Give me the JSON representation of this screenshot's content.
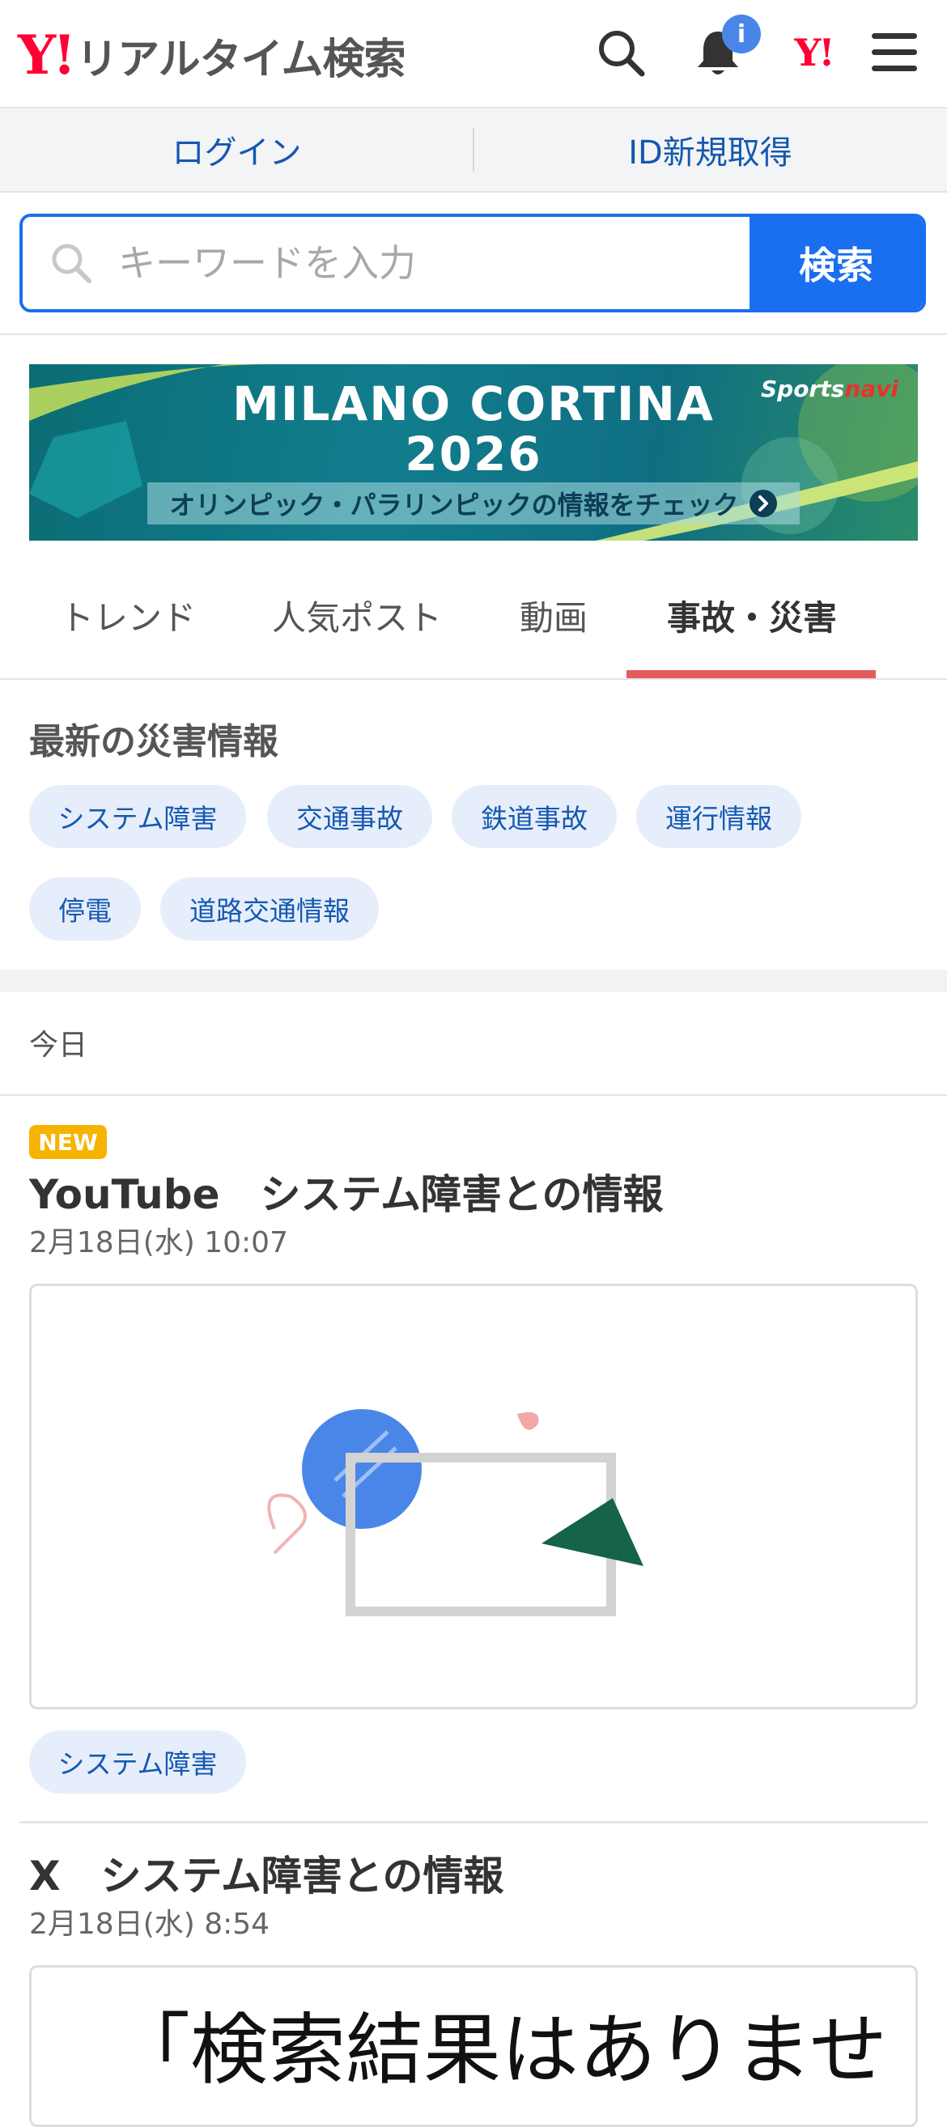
{
  "header": {
    "logo_y": "Y!",
    "logo_text": "リアルタイム検索",
    "notification_badge": "i",
    "yahoo_mini": "Y!"
  },
  "login_bar": {
    "login": "ログイン",
    "signup": "ID新規取得"
  },
  "search": {
    "placeholder": "キーワードを入力",
    "button": "検索"
  },
  "banner": {
    "title_line1": "MILANO CORTINA",
    "title_line2": "2026",
    "subtitle": "オリンピック・パラリンピックの情報をチェック",
    "brand_prefix": "Sports",
    "brand_suffix": "navi"
  },
  "tabs": [
    {
      "label": "トレンド",
      "active": false
    },
    {
      "label": "人気ポスト",
      "active": false
    },
    {
      "label": "動画",
      "active": false
    },
    {
      "label": "事故・災害",
      "active": true
    }
  ],
  "disaster": {
    "title": "最新の災害情報",
    "chips": [
      "システム障害",
      "交通事故",
      "鉄道事故",
      "運行情報",
      "停電",
      "道路交通情報"
    ]
  },
  "timeline": {
    "today_label": "今日"
  },
  "articles": [
    {
      "new_badge": "NEW",
      "title": "YouTube　システム障害との情報",
      "date": "2月18日(水) 10:07",
      "tag": "システム障害"
    },
    {
      "title": "X　システム障害との情報",
      "date": "2月18日(水) 8:54",
      "image_text": "「検索結果はありませ"
    }
  ],
  "colors": {
    "brand_red": "#ff0033",
    "accent_blue": "#1a6ff0",
    "link_blue": "#1558b0",
    "tab_underline": "#e35d5d",
    "new_badge": "#f6b400"
  }
}
